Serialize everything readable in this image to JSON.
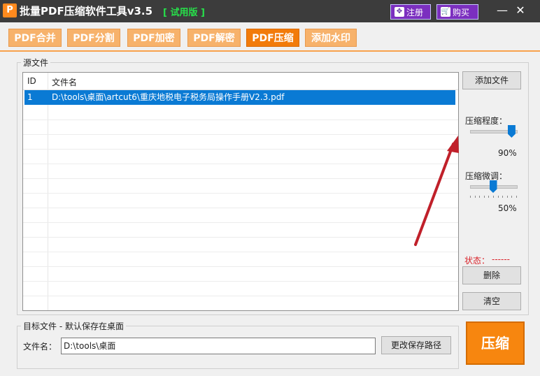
{
  "window": {
    "title": "批量PDF压缩软件工具v3.5",
    "trial_badge": "[ 试用版 ]",
    "register_label": "注册",
    "buy_label": "购买",
    "minimize_glyph": "—",
    "close_glyph": "✕",
    "icon_letter": "P"
  },
  "tabs": [
    {
      "label": "PDF合并"
    },
    {
      "label": "PDF分割"
    },
    {
      "label": "PDF加密"
    },
    {
      "label": "PDF解密"
    },
    {
      "label": "PDF压缩",
      "active": true
    },
    {
      "label": "添加水印"
    }
  ],
  "source": {
    "group_label": "源文件",
    "columns": [
      "ID",
      "文件名"
    ],
    "rows": [
      {
        "id": "1",
        "name": "D:\\tools\\桌面\\artcut6\\重庆地税电子税务局操作手册V2.3.pdf"
      }
    ]
  },
  "side": {
    "add_file_label": "添加文件",
    "compression_level_label": "压缩程度：",
    "compression_level_value": "90%",
    "fine_tune_label": "压缩微调：",
    "fine_tune_value": "50%",
    "status_label": "状态：",
    "status_value": "------",
    "delete_label": "删除",
    "clear_label": "清空"
  },
  "target": {
    "group_label": "目标文件 - 默认保存在桌面",
    "filename_label": "文件名：",
    "filename_value": "D:\\tools\\桌面",
    "change_path_label": "更改保存路径"
  },
  "compress_button_label": "压缩",
  "colors": {
    "accent_orange": "#f27b0a",
    "tab_orange": "#f7b26b",
    "selection_blue": "#0a7ad4",
    "status_red": "#d9232a",
    "trial_green": "#27e04a",
    "arrow_red": "#c0202a"
  },
  "sliders": {
    "compression_level": 0.9,
    "fine_tune": 0.5
  }
}
